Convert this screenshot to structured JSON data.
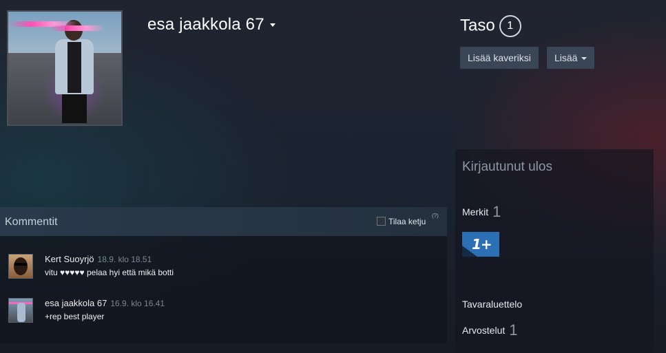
{
  "profile": {
    "name": "esa jaakkola 67",
    "level_label": "Taso",
    "level": "1",
    "add_friend_label": "Lisää kaveriksi",
    "more_label": "Lisää"
  },
  "sidebar": {
    "status": "Kirjautunut ulos",
    "badges_label": "Merkit",
    "badges_count": "1",
    "badge_text": "1+",
    "inventory_label": "Tavaraluettelo",
    "reviews_label": "Arvostelut",
    "reviews_count": "1"
  },
  "comments": {
    "title": "Kommentit",
    "subscribe_label": "Tilaa ketju",
    "help": "(?)",
    "items": [
      {
        "author": "Kert Suoyrjö",
        "time": "18.9. klo 18.51",
        "text": "vitu ♥♥♥♥♥ pelaa hyi että mikä botti"
      },
      {
        "author": "esa jaakkola 67",
        "time": "16.9. klo 16.41",
        "text": "+rep best player"
      }
    ]
  }
}
